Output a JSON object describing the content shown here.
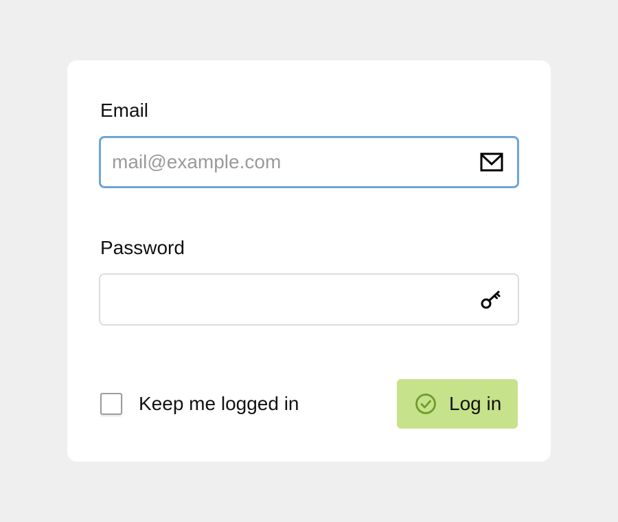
{
  "form": {
    "email_label": "Email",
    "email_value": "",
    "email_placeholder": "mail@example.com",
    "email_icon": "mail-icon",
    "password_label": "Password",
    "password_value": "",
    "password_placeholder": "",
    "password_icon": "key-icon",
    "keep_logged_in_label": "Keep me logged in",
    "keep_logged_in_checked": false,
    "login_button_label": "Log in",
    "login_button_icon": "check-circle-icon"
  },
  "colors": {
    "page_background": "#efefef",
    "card_background": "#ffffff",
    "focus_border": "#6ea4d6",
    "field_border": "#dcdcdc",
    "login_button": "#c6e28a",
    "login_icon": "#6f9a2a"
  }
}
